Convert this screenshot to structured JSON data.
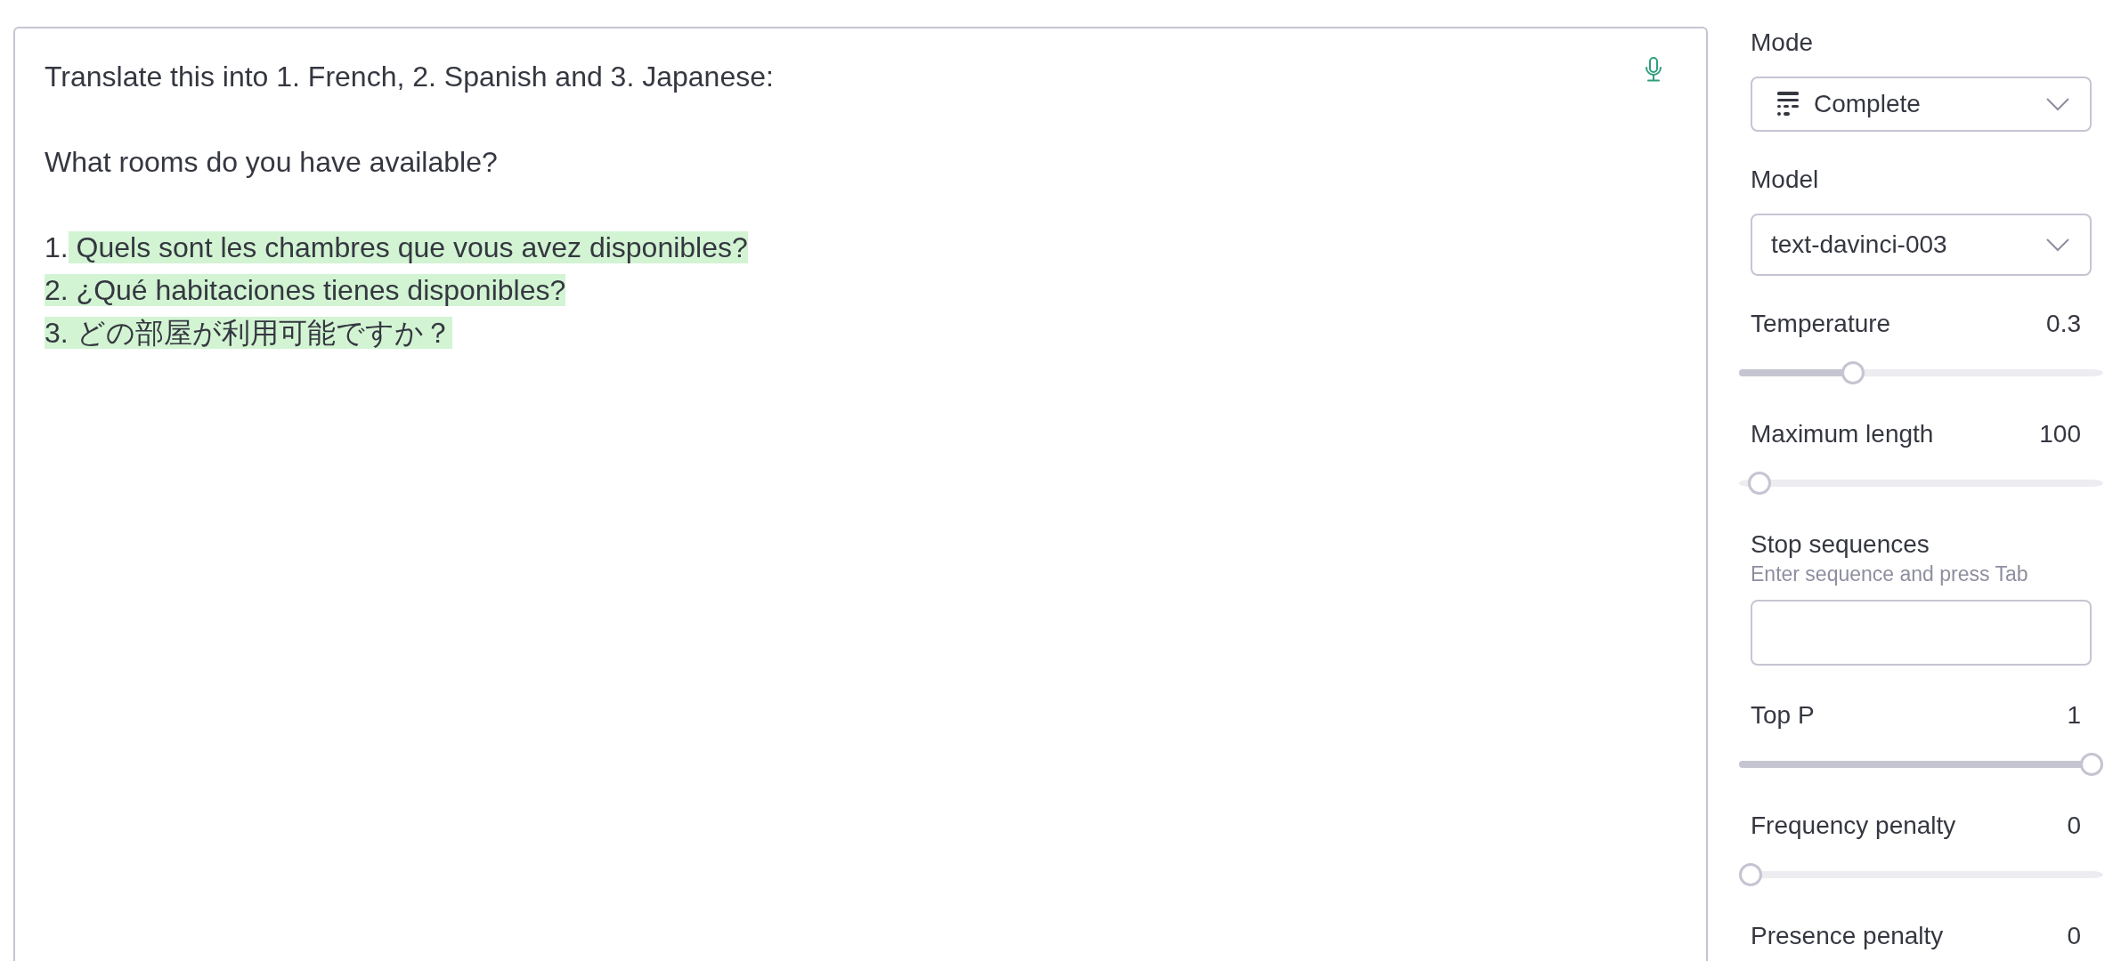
{
  "editor": {
    "paragraphs": [
      {
        "lines": [
          {
            "segments": [
              {
                "text": "Translate this into 1. French, 2. Spanish and 3. Japanese:",
                "generated": false
              }
            ]
          }
        ]
      },
      {
        "lines": [
          {
            "segments": [
              {
                "text": "What rooms do you have available?",
                "generated": false
              }
            ]
          }
        ]
      },
      {
        "lines": [
          {
            "segments": [
              {
                "text": "1.",
                "generated": false
              },
              {
                "text": " Quels sont les chambres que vous avez disponibles?",
                "generated": true
              }
            ]
          },
          {
            "segments": [
              {
                "text": "2. ¿Qué habitaciones tienes disponibles?",
                "generated": true
              }
            ]
          },
          {
            "segments": [
              {
                "text": "3. どの部屋が利用可能ですか？",
                "generated": true
              }
            ]
          }
        ]
      }
    ]
  },
  "settings": [
    {
      "kind": "select",
      "label": "Mode",
      "value": "Complete",
      "icon": true
    },
    {
      "kind": "select",
      "label": "Model",
      "value": "text-davinci-003",
      "icon": false
    },
    {
      "kind": "slider",
      "label": "Temperature",
      "value": "0.3",
      "level": 0.3
    },
    {
      "kind": "slider",
      "label": "Maximum length",
      "value": "100",
      "level": 0.025
    },
    {
      "kind": "sequences",
      "label": "Stop sequences",
      "hint": "Enter sequence and press Tab"
    },
    {
      "kind": "slider",
      "label": "Top P",
      "value": "1",
      "level": 1
    },
    {
      "kind": "slider",
      "label": "Frequency penalty",
      "value": "0",
      "level": 0
    },
    {
      "kind": "slider",
      "label": "Presence penalty",
      "value": "0"
    }
  ]
}
